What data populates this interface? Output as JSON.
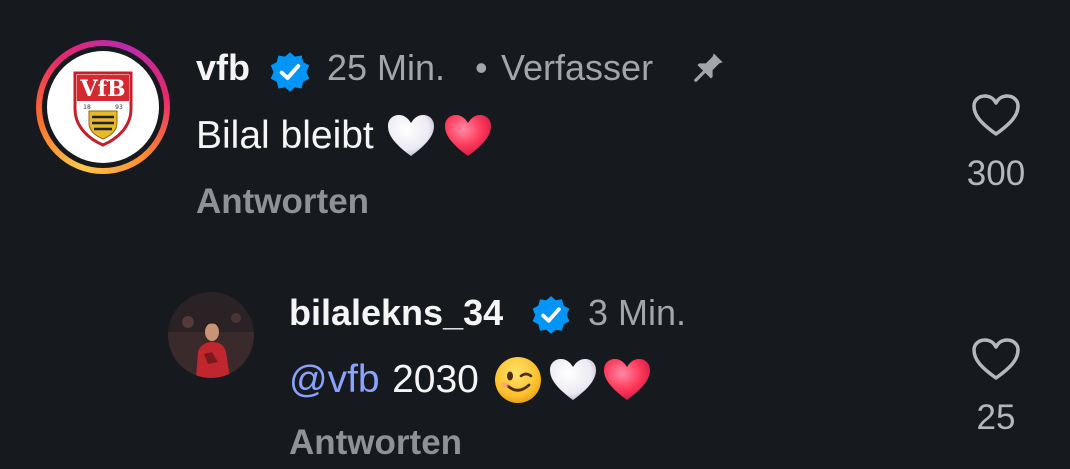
{
  "comments": [
    {
      "username": "vfb",
      "verified": true,
      "time": "25 Min.",
      "separator": "•",
      "role": "Verfasser",
      "pinned": true,
      "text": "Bilal bleibt",
      "emojis": [
        "white-heart",
        "red-heart"
      ],
      "reply_label": "Antworten",
      "likes": "300",
      "avatar": "vfb-stuttgart-crest"
    },
    {
      "username": "bilalekns_34",
      "verified": true,
      "time": "3 Min.",
      "mention": "vfb",
      "text": "2030",
      "emojis": [
        "winking-face",
        "white-heart",
        "red-heart"
      ],
      "reply_label": "Antworten",
      "likes": "25",
      "avatar": "user-photo"
    }
  ],
  "colors": {
    "background": "#16191d",
    "verified_badge": "#0095f6",
    "mention": "#8aa2ff",
    "muted_text": "#a2a6ab"
  }
}
